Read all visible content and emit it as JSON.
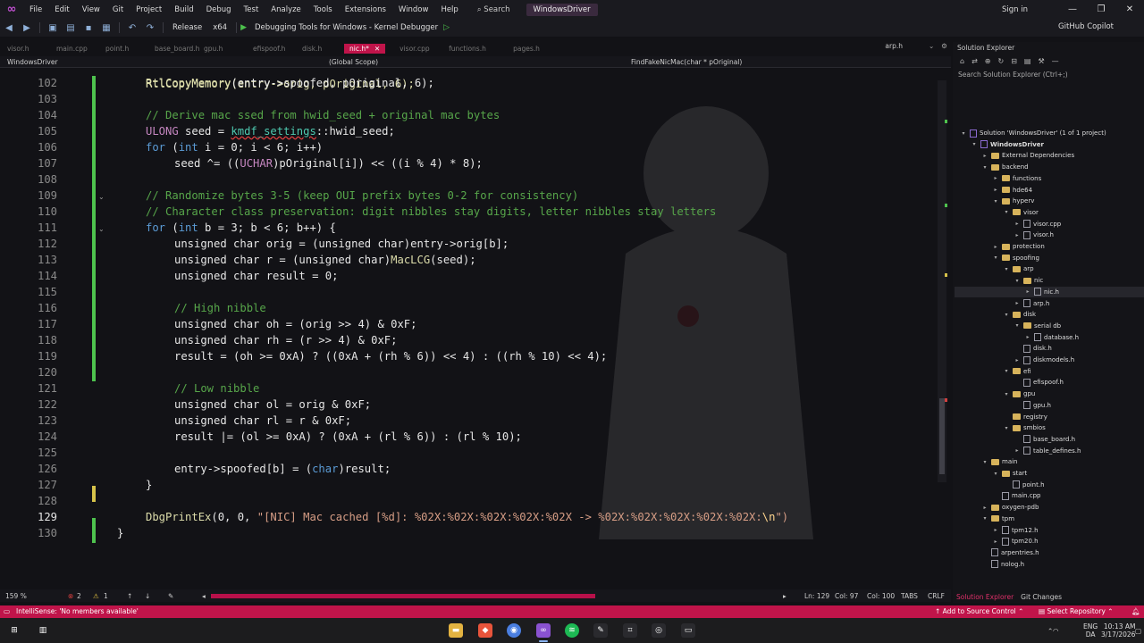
{
  "app": {
    "menu": [
      "File",
      "Edit",
      "View",
      "Git",
      "Project",
      "Build",
      "Debug",
      "Test",
      "Analyze",
      "Tools",
      "Extensions",
      "Window",
      "Help"
    ],
    "search_label": "Search",
    "solution_name": "WindowsDriver",
    "sign_in": "Sign in",
    "window_controls": [
      "—",
      "❐",
      "✕"
    ]
  },
  "toolbar": {
    "configuration": "Release",
    "platform": "x64",
    "debugger": "Debugging Tools for Windows - Kernel Debugger",
    "copilot": "GitHub Copilot"
  },
  "tabs": {
    "items": [
      "visor.h",
      "main.cpp",
      "point.h",
      "base_board.h",
      "gpu.h",
      "efispoof.h",
      "disk.h"
    ],
    "active": "nic.h*",
    "items_after": [
      "visor.cpp",
      "functions.h",
      "pages.h"
    ],
    "right": "arp.h"
  },
  "navbar": {
    "project": "WindowsDriver",
    "scope": "(Global Scope)",
    "function": "FindFakeNicMac(char * pOriginal)"
  },
  "editor": {
    "zoom": "159 %",
    "errors": "2",
    "warnings": "1",
    "line": "Ln: 129",
    "col": "Col: 97",
    "ch": "Col: 100",
    "tabs": "TABS",
    "eol": "CRLF",
    "line_numbers": [
      "102",
      "103",
      "104",
      "105",
      "106",
      "107",
      "108",
      "109",
      "110",
      "111",
      "112",
      "113",
      "114",
      "115",
      "116",
      "117",
      "118",
      "119",
      "120",
      "121",
      "122",
      "123",
      "124",
      "125",
      "126",
      "127",
      "128",
      "129",
      "130"
    ],
    "partial_line": "RtlCopyMemory(entry->orig, pOriginal, 6);",
    "code": {
      "l102": "RtlCopyMemory",
      "l102b": "(entry->spoofed, pOriginal, 6);",
      "l104": "// Derive mac ssed from hwid_seed + original mac bytes",
      "l105a": "ULONG",
      "l105b": " seed = ",
      "l105c": "kmdf_settings",
      "l105d": "::hwid_seed;",
      "l106a": "for",
      "l106b": " (",
      "l106c": "int",
      "l106d": " i = 0; i < 6; i++)",
      "l107a": "seed ^= ((",
      "l107b": "UCHAR",
      "l107c": ")pOriginal[i]) << ((i % 4) * 8);",
      "l109": "// Randomize bytes 3-5 (keep OUI prefix bytes 0-2 for consistency)",
      "l110": "// Character class preservation: digit nibbles stay digits, letter nibbles stay letters",
      "l111a": "for",
      "l111b": " (",
      "l111c": "int",
      "l111d": " b = 3; b < 6; b++) {",
      "l112": "unsigned char orig = (unsigned char)entry->orig[b];",
      "l113a": "unsigned char r = (unsigned char)",
      "l113b": "MacLCG",
      "l113c": "(seed);",
      "l114": "unsigned char result = 0;",
      "l116": "// High nibble",
      "l117": "unsigned char oh = (orig >> 4) & 0xF;",
      "l118": "unsigned char rh = (r >> 4) & 0xF;",
      "l119": "result = (oh >= 0xA) ? ((0xA + (rh % 6)) << 4) : ((rh % 10) << 4);",
      "l121": "// Low nibble",
      "l122": "unsigned char ol = orig & 0xF;",
      "l123": "unsigned char rl = r & 0xF;",
      "l124": "result |= (ol >= 0xA) ? (0xA + (rl % 6)) : (rl % 10);",
      "l126a": "entry->spoofed[b] = (",
      "l126b": "char",
      "l126c": ")result;",
      "l127": "}",
      "l129a": "DbgPrintEx",
      "l129b": "(0, 0, ",
      "l129c": "\"[NIC] Mac cached [%d]: %02X:%02X:%02X:%02X:%02X -> %02X:%02X:%02X:%02X:%02X:",
      "l129d": "\\n",
      "l129e": "\")",
      "l130": "}"
    }
  },
  "solution_explorer": {
    "title": "Solution Explorer",
    "search_placeholder": "Search Solution Explorer (Ctrl+;)",
    "solution": "Solution 'WindowsDriver' (1 of 1 project)",
    "tree": [
      "WindowsDriver",
      "External Dependencies",
      "backend",
      "functions",
      "hde64",
      "hyperv",
      "visor",
      "visor.cpp",
      "visor.h",
      "protection",
      "spoofing",
      "arp",
      "nic",
      "nic.h",
      "arp.h",
      "disk",
      "serial db",
      "database.h",
      "disk.h",
      "diskmodels.h",
      "efi",
      "efispoof.h",
      "gpu",
      "gpu.h",
      "registry",
      "smbios",
      "base_board.h",
      "table_defines.h",
      "main",
      "start",
      "point.h",
      "main.cpp",
      "oxygen-pdb",
      "tpm",
      "tpm12.h",
      "tpm20.h",
      "arpentries.h",
      "nolog.h"
    ],
    "tab_a": "Solution Explorer",
    "tab_b": "Git Changes"
  },
  "statusbar": {
    "message": "IntelliSense: 'No members available'",
    "source_control": "Add to Source Control",
    "repo": "Select Repository"
  },
  "taskbar": {
    "lang1": "ENG",
    "lang2": "DA",
    "time": "10:13 AM",
    "date": "3/17/2026"
  },
  "colors": {
    "accent": "#c0144a",
    "background": "#121216",
    "keyword": "#5b9bd5",
    "comment": "#57a64a"
  }
}
